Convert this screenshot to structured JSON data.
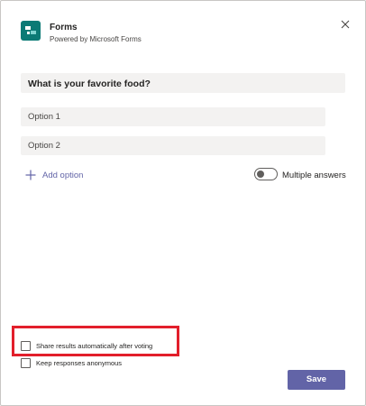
{
  "header": {
    "app_title": "Forms",
    "app_subtitle": "Powered by Microsoft Forms",
    "app_icon": "forms-icon",
    "close_icon": "close-icon"
  },
  "poll": {
    "question": "What is your favorite food?",
    "options": [
      {
        "label": "Option 1"
      },
      {
        "label": "Option 2"
      }
    ],
    "add_option_label": "Add option",
    "multiple_answers_label": "Multiple answers",
    "multiple_answers_enabled": false
  },
  "settings": {
    "share_results_label": "Share results automatically after voting",
    "share_results_checked": false,
    "anonymous_label": "Keep responses anonymous",
    "anonymous_checked": false
  },
  "footer": {
    "save_label": "Save"
  },
  "colors": {
    "accent": "#6264a7",
    "forms_brand": "#0b7a75",
    "highlight": "#e21f2b",
    "field_bg": "#f3f2f1"
  }
}
